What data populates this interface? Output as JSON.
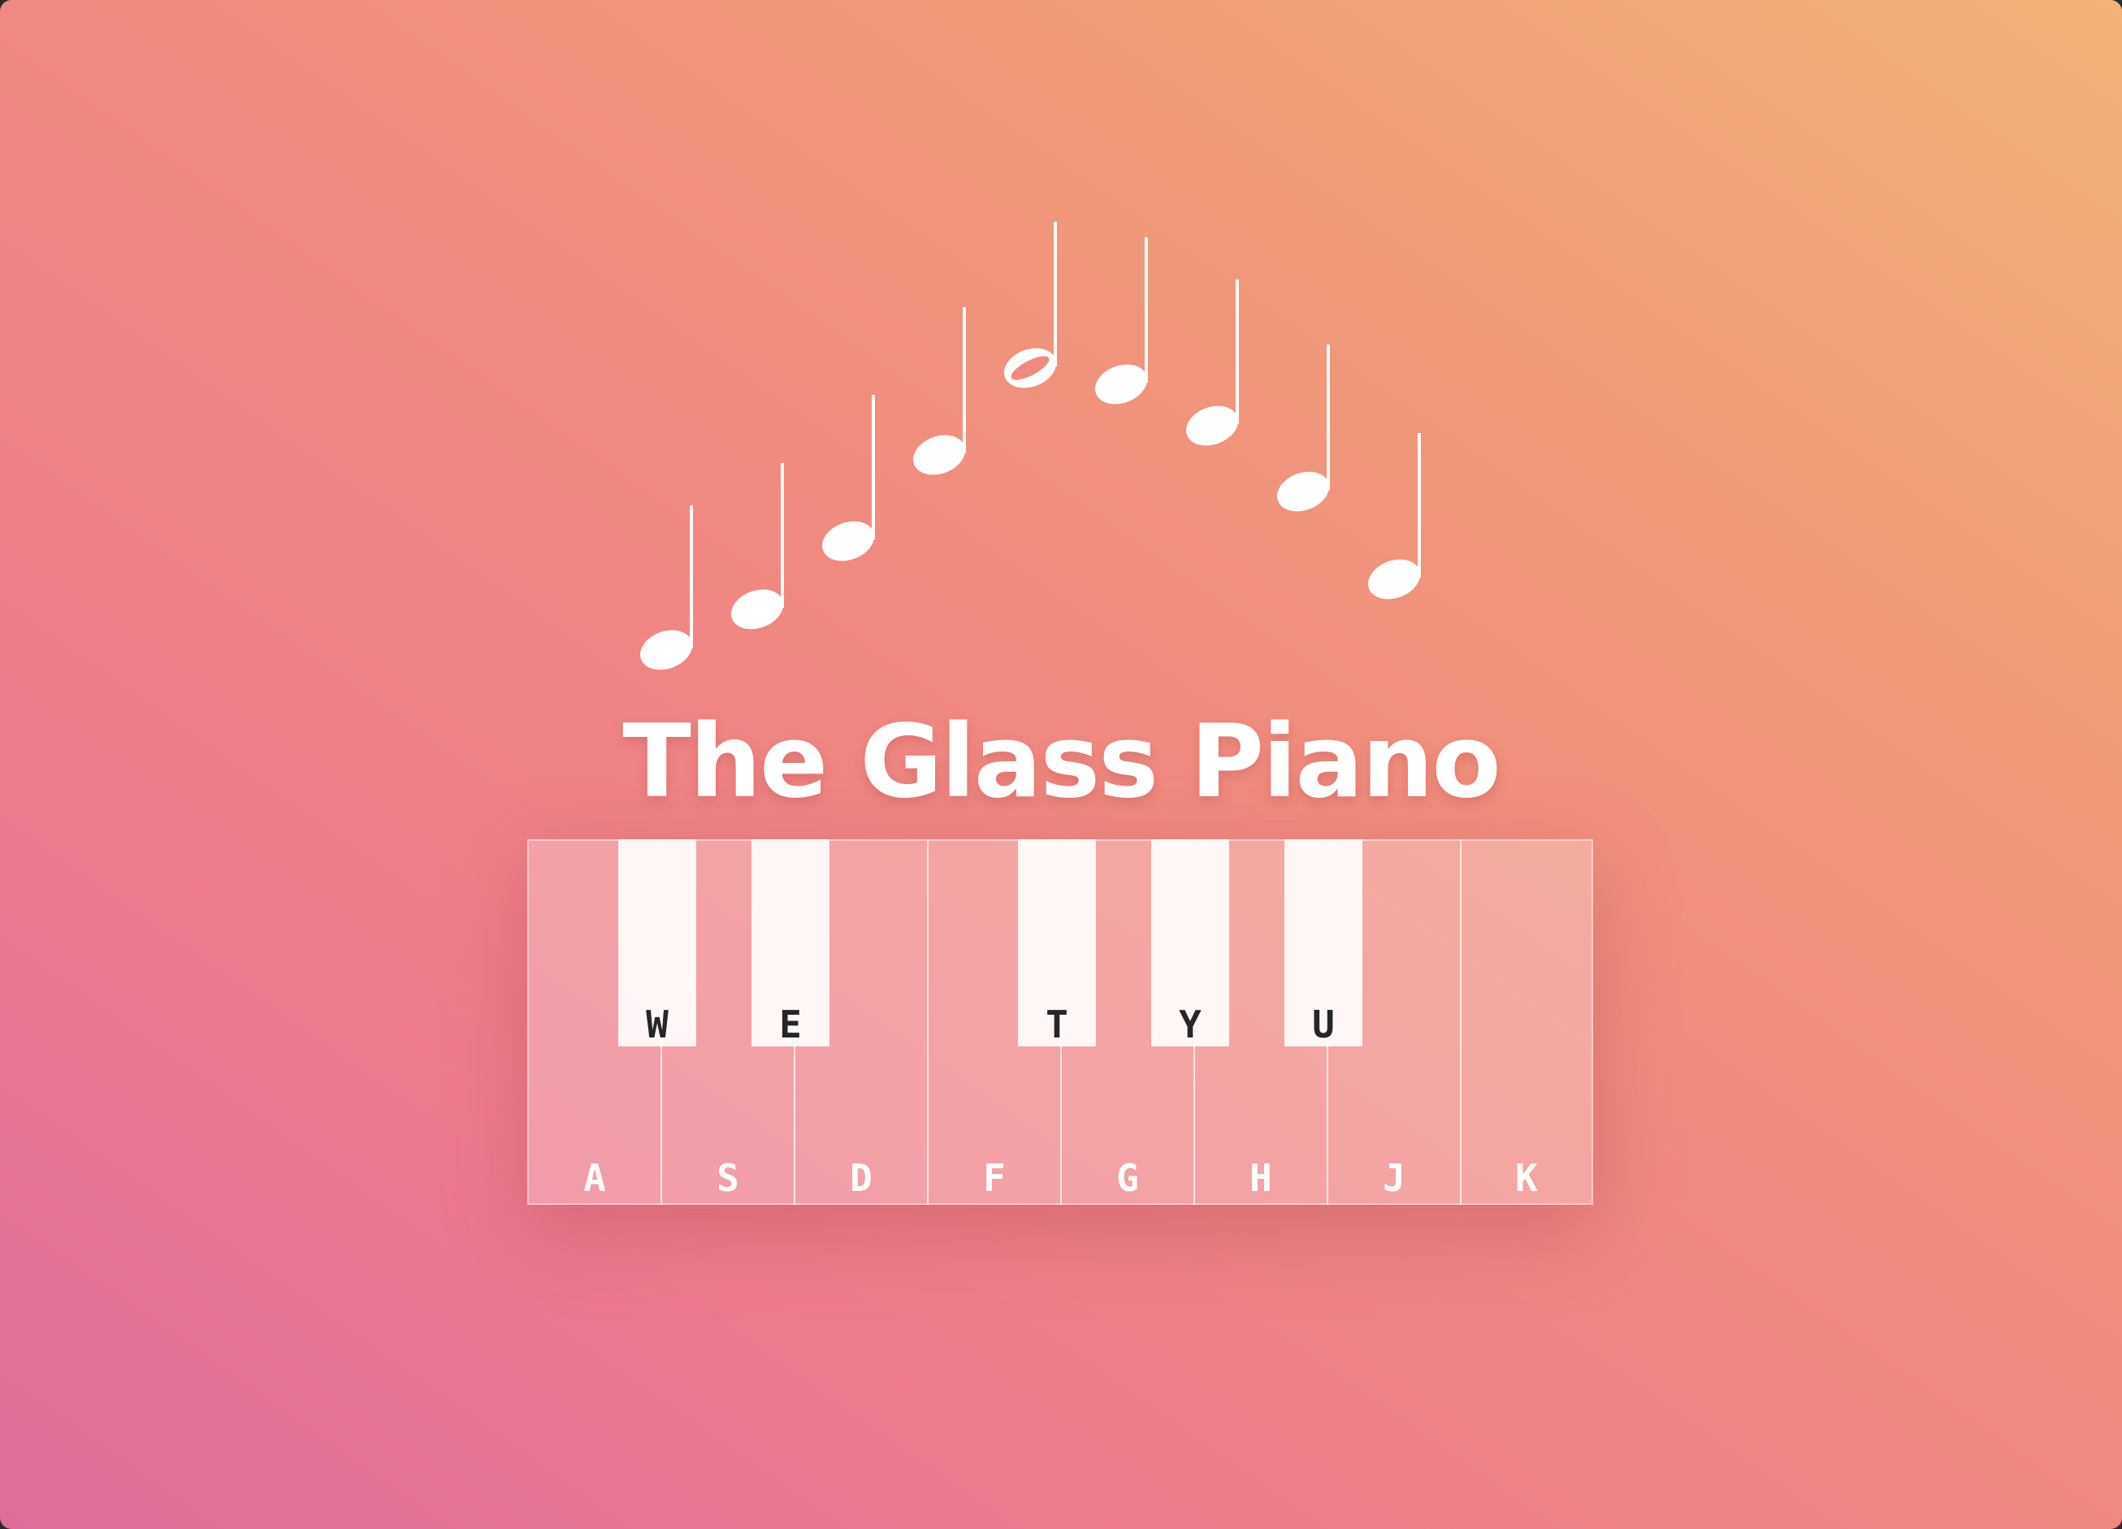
{
  "app": {
    "title": "The Glass Piano"
  },
  "decoration": {
    "notes_icon": "music-notes-arc",
    "hollow_note_icon": "half-note",
    "filled_note_icon": "quarter-note"
  },
  "piano": {
    "white_keys": [
      "A",
      "S",
      "D",
      "F",
      "G",
      "H",
      "J",
      "K"
    ],
    "black_keys": [
      "W",
      "E",
      "T",
      "Y",
      "U"
    ]
  },
  "colors": {
    "gradient": [
      "#de6d9b",
      "#ee7a8d",
      "#f08a80",
      "#f09c78",
      "#f3b277"
    ],
    "text": "#ffffff",
    "black_key_label": "#262626"
  }
}
